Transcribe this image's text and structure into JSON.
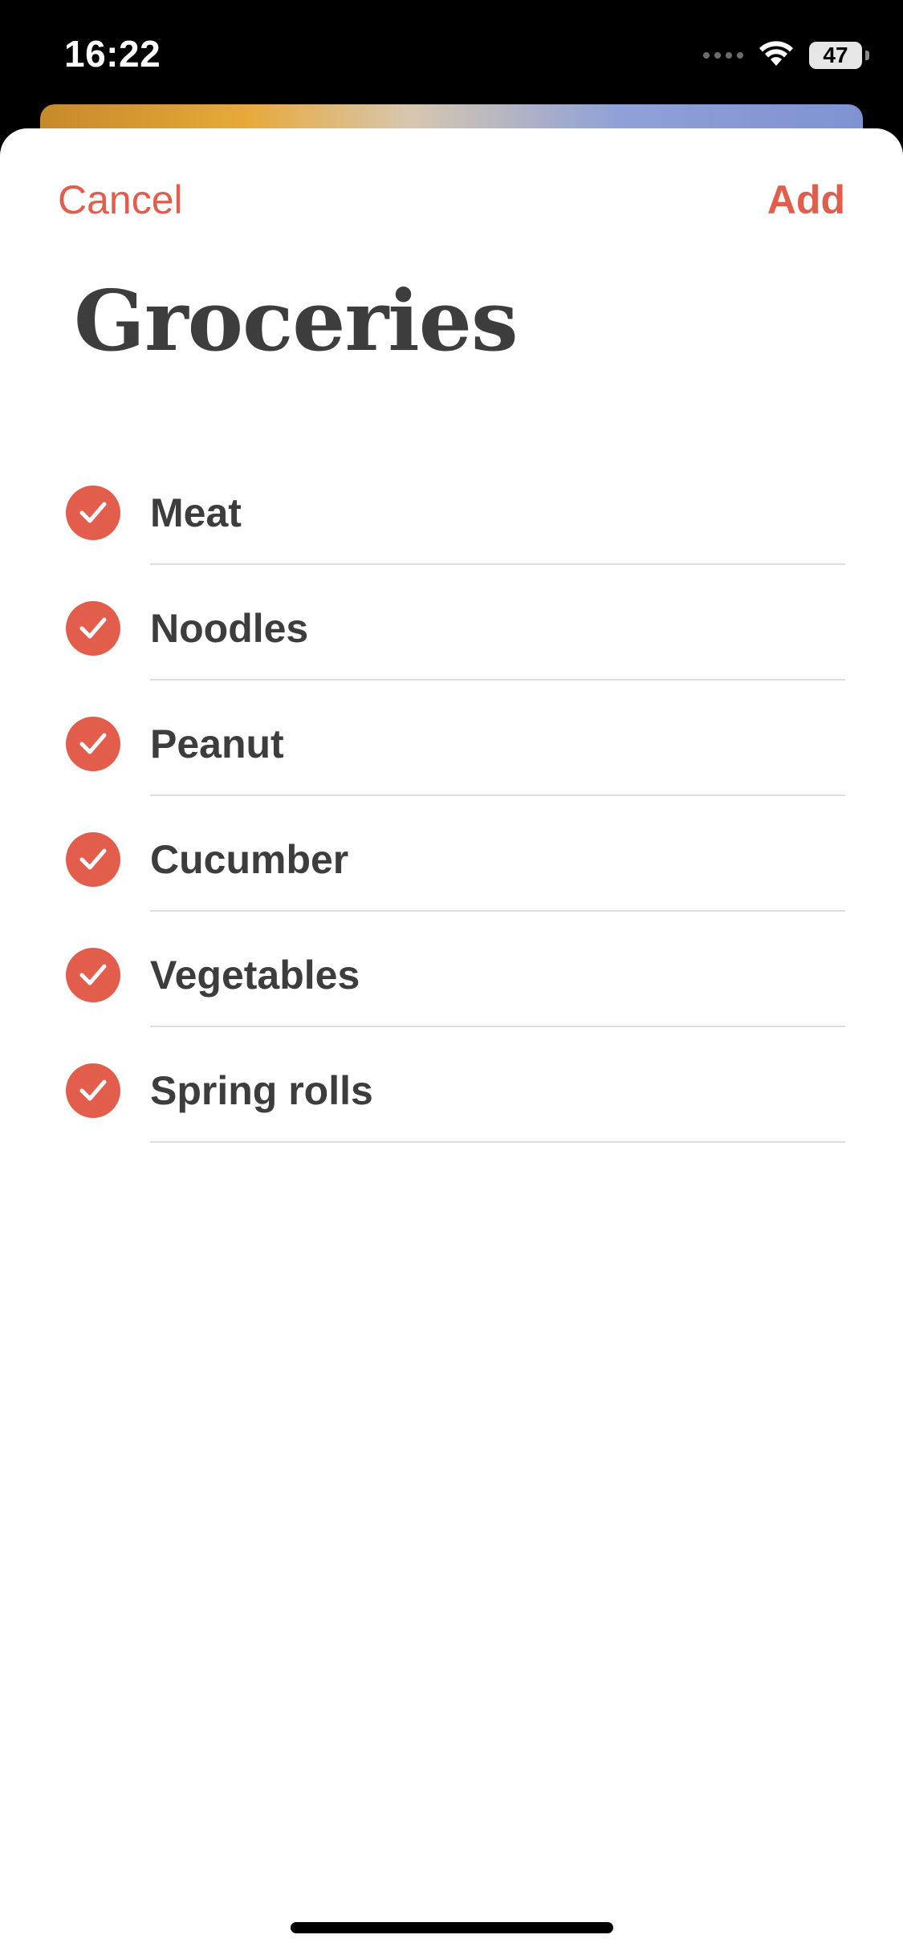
{
  "status_bar": {
    "time": "16:22",
    "battery": "47",
    "icons": [
      "signal-dots-icon",
      "wifi-icon",
      "battery-icon"
    ]
  },
  "nav": {
    "cancel_label": "Cancel",
    "add_label": "Add"
  },
  "title": "Groceries",
  "items": [
    {
      "label": "Meat",
      "checked": true
    },
    {
      "label": "Noodles",
      "checked": true
    },
    {
      "label": "Peanut",
      "checked": true
    },
    {
      "label": "Cucumber",
      "checked": true
    },
    {
      "label": "Vegetables",
      "checked": true
    },
    {
      "label": "Spring rolls",
      "checked": true
    }
  ],
  "colors": {
    "accent": "#e35d4d",
    "text": "#3d3d3d",
    "divider": "#dedede"
  }
}
